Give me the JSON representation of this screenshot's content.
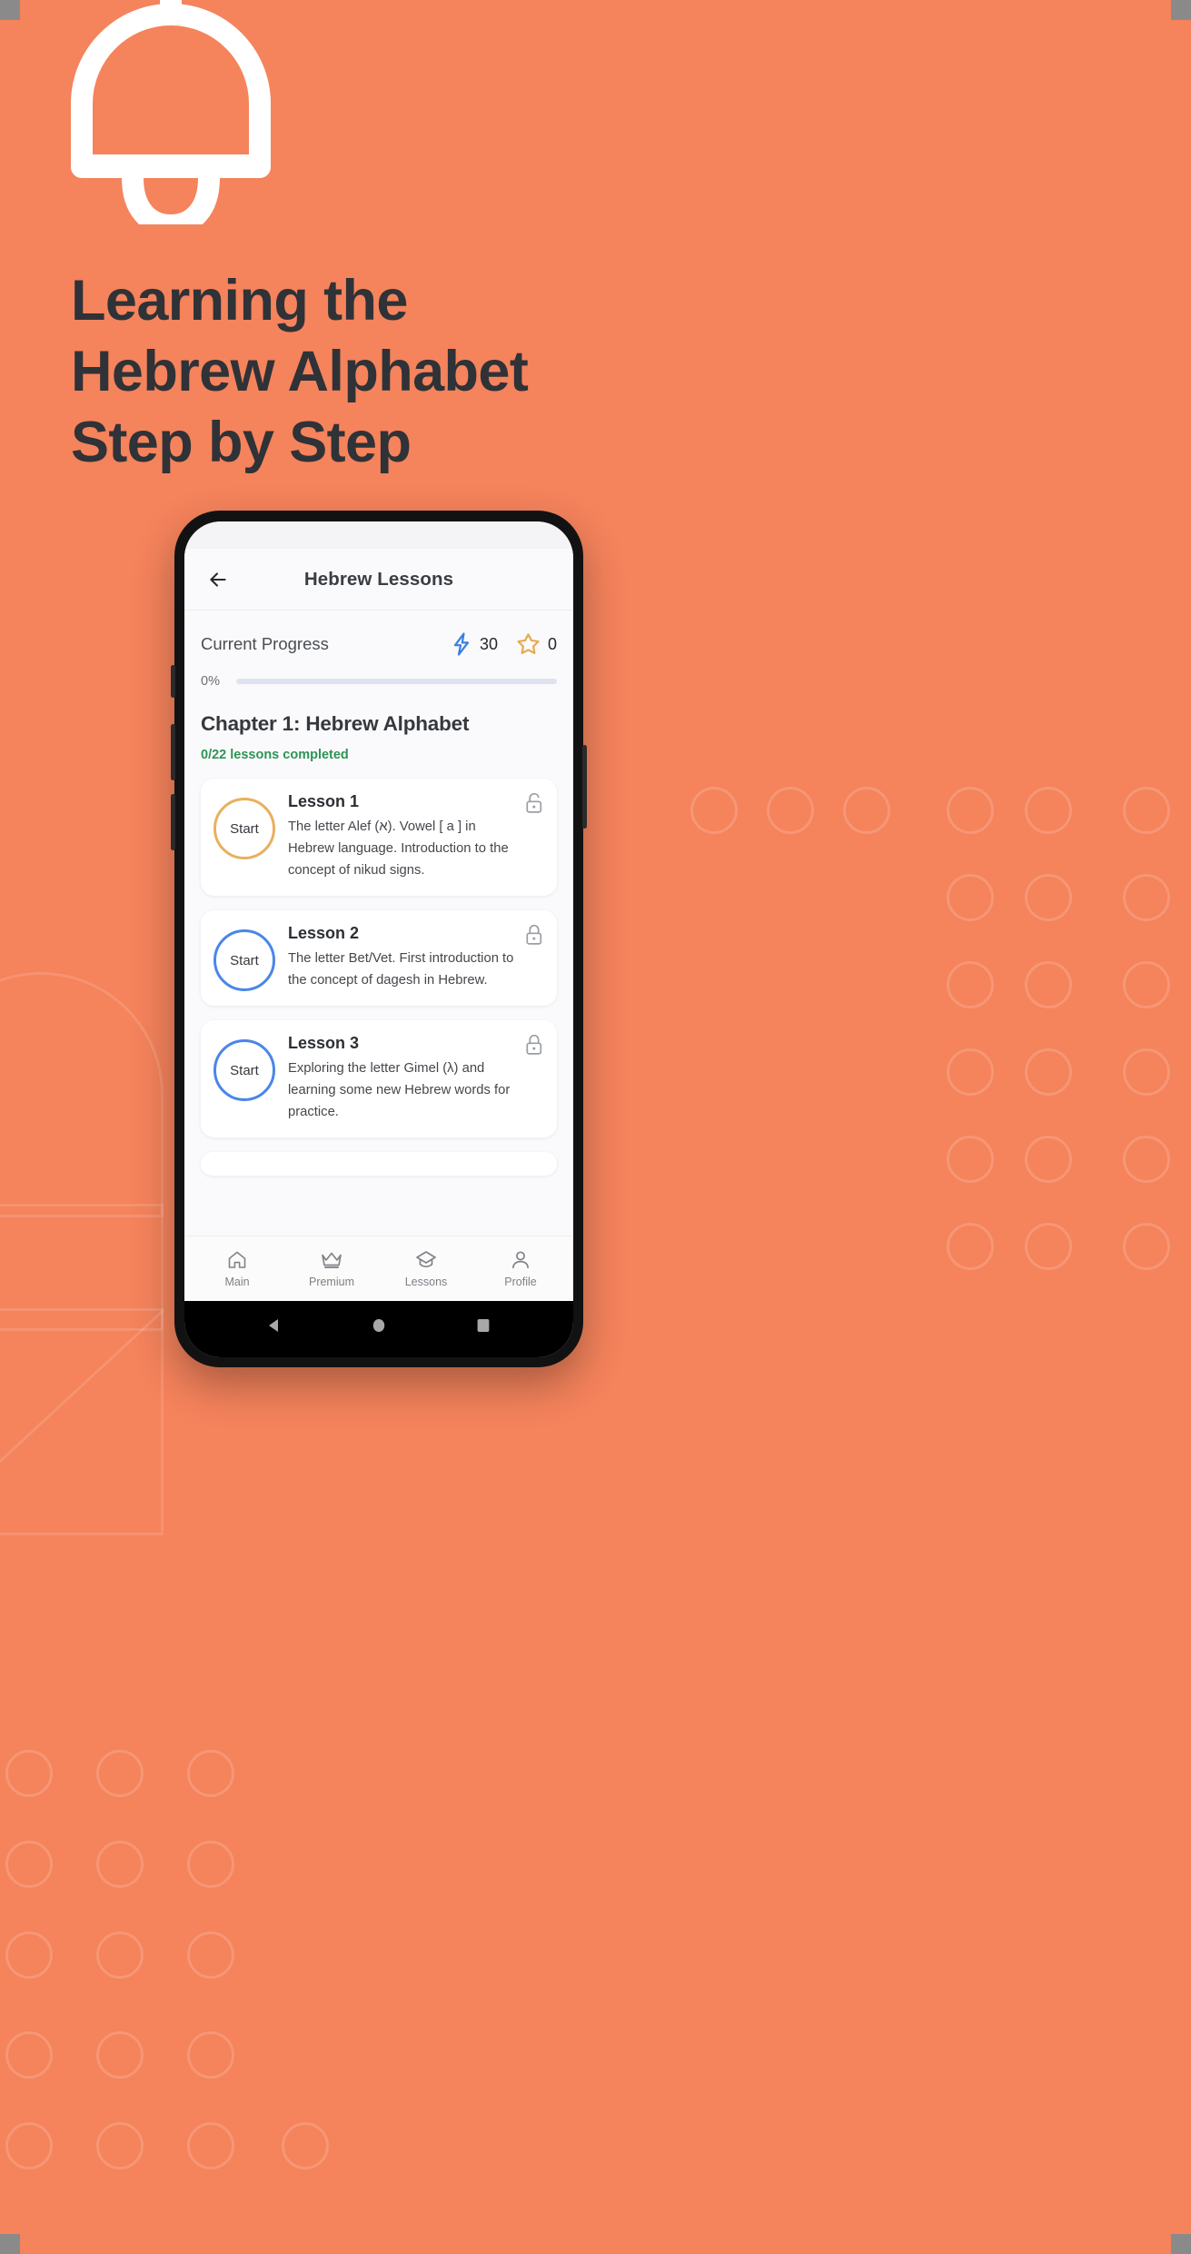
{
  "poster": {
    "background_color": "#F5835C",
    "logo_icon": "bell-icon",
    "headline_lines": [
      "Learning the",
      "Hebrew Alphabet",
      "Step by Step"
    ],
    "headline_color": "#2F3237"
  },
  "app": {
    "appbar": {
      "back_icon": "arrow-left-icon",
      "title": "Hebrew Lessons"
    },
    "progress": {
      "label": "Current Progress",
      "percent_label": "0%",
      "percent_value": 0,
      "stats": [
        {
          "icon": "lightning-bolt-icon",
          "value": "30",
          "color": "#3B7DE0"
        },
        {
          "icon": "star-outline-icon",
          "value": "0",
          "color": "#E8A94E"
        }
      ],
      "track_color": "#DEE3EF",
      "fill_color": "#4A86E8"
    },
    "chapter": {
      "title": "Chapter 1: Hebrew Alphabet",
      "completed_text": "0/22 lessons completed",
      "completed_color": "#2E9355"
    },
    "lessons": [
      {
        "start_label": "Start",
        "ring_color": "#E8B05E",
        "title": "Lesson 1",
        "description": "The letter Alef (א). Vowel [ a ] in Hebrew language. Introduction to the concept of nikud signs.",
        "lock_icon": "unlock-icon"
      },
      {
        "start_label": "Start",
        "ring_color": "#4A86E8",
        "title": "Lesson 2",
        "description": "The letter Bet/Vet. First introduction to the concept of dagesh in Hebrew.",
        "lock_icon": "lock-icon"
      },
      {
        "start_label": "Start",
        "ring_color": "#4A86E8",
        "title": "Lesson 3",
        "description": "Exploring the letter Gimel (λ) and learning some new Hebrew words for practice.",
        "lock_icon": "lock-icon"
      }
    ],
    "bottom_nav": [
      {
        "icon": "home-icon",
        "label": "Main"
      },
      {
        "icon": "crown-icon",
        "label": "Premium"
      },
      {
        "icon": "graduation-cap-icon",
        "label": "Lessons"
      },
      {
        "icon": "person-icon",
        "label": "Profile"
      }
    ],
    "system_nav": [
      {
        "icon": "back-triangle-icon"
      },
      {
        "icon": "home-circle-icon"
      },
      {
        "icon": "recents-square-icon"
      }
    ]
  }
}
